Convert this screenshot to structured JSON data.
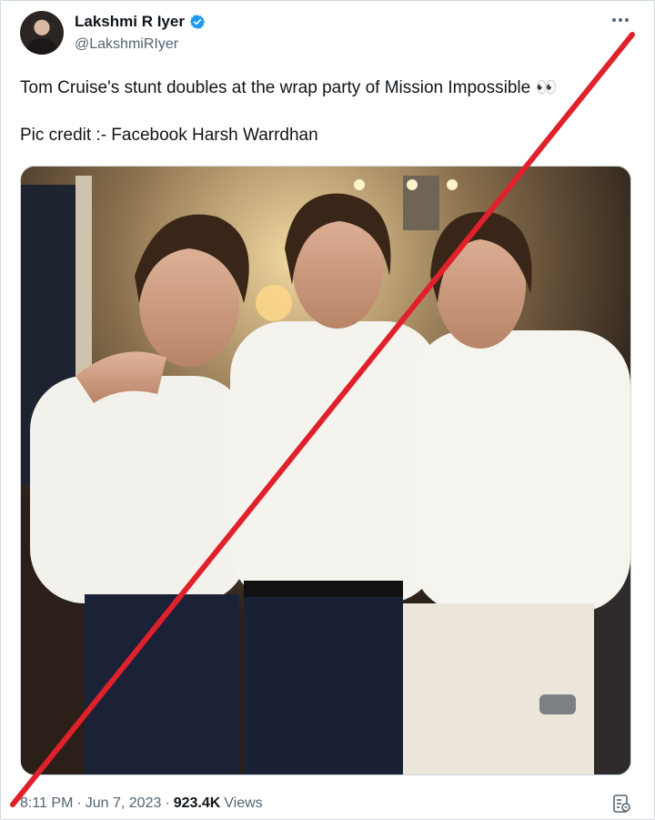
{
  "author": {
    "display_name": "Lakshmi R Iyer",
    "handle": "@LakshmiRIyer",
    "verified": true,
    "verified_color": "#1d9bf0"
  },
  "tweet": {
    "text_line1": "Tom Cruise's stunt doubles at the wrap party of Mission Impossible 👀",
    "text_line2": "Pic credit :- Facebook Harsh Warrdhan",
    "time": "8:11 PM",
    "separator": "·",
    "date": "Jun 7, 2023",
    "views_count": "923.4K",
    "views_label": "Views"
  },
  "icons": {
    "more": "more-horizontal-icon",
    "verified": "verified-badge-icon",
    "analytics": "analytics-icon"
  },
  "overlay": {
    "strike_color": "#e0202a"
  }
}
